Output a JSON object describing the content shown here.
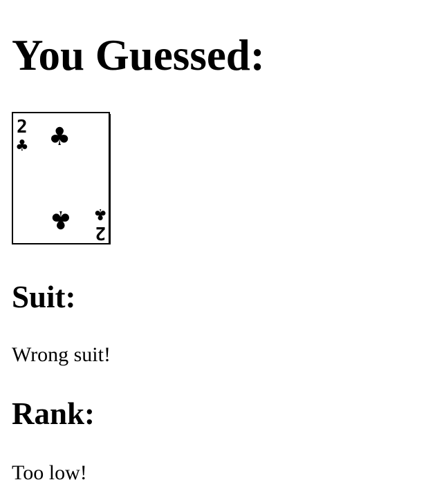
{
  "page": {
    "title": "You Guessed:"
  },
  "card": {
    "rank": "2",
    "suit": "clubs",
    "suit_symbol": "♣",
    "icon": "playing-card-two-of-clubs"
  },
  "suit_section": {
    "heading": "Suit:",
    "result": "Wrong suit!"
  },
  "rank_section": {
    "heading": "Rank:",
    "result": "Too low!"
  }
}
